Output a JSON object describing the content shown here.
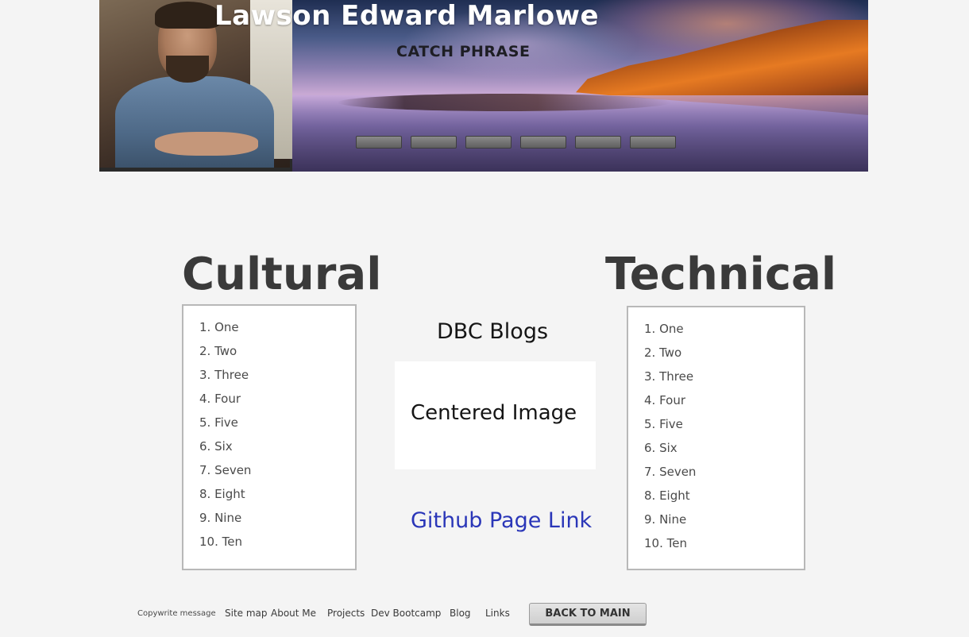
{
  "header": {
    "name": "Lawson Edward Marlowe",
    "catch_phrase": "CATCH PHRASE",
    "nav_button_count": 6
  },
  "cultural": {
    "title": "Cultural",
    "items": [
      "1. One",
      "2. Two",
      "3. Three",
      "4. Four",
      "5. Five",
      "6. Six",
      "7. Seven",
      "8. Eight",
      "9. Nine",
      "10. Ten"
    ]
  },
  "technical": {
    "title": "Technical",
    "items": [
      "1. One",
      "2. Two",
      "3. Three",
      "4. Four",
      "5. Five",
      "6. Six",
      "7. Seven",
      "8. Eight",
      "9. Nine",
      "10. Ten"
    ]
  },
  "center": {
    "blogs_label": "DBC Blogs",
    "image_label": "Centered Image",
    "github_link": "Github Page Link"
  },
  "footer": {
    "copyright": "Copywrite message",
    "links": [
      "Site map",
      "About Me",
      "Projects",
      "Dev Bootcamp",
      "Blog",
      "Links"
    ],
    "back_button": "BACK TO MAIN"
  },
  "colors": {
    "link": "#2a36b8",
    "page_background": "#f4f4f4"
  }
}
